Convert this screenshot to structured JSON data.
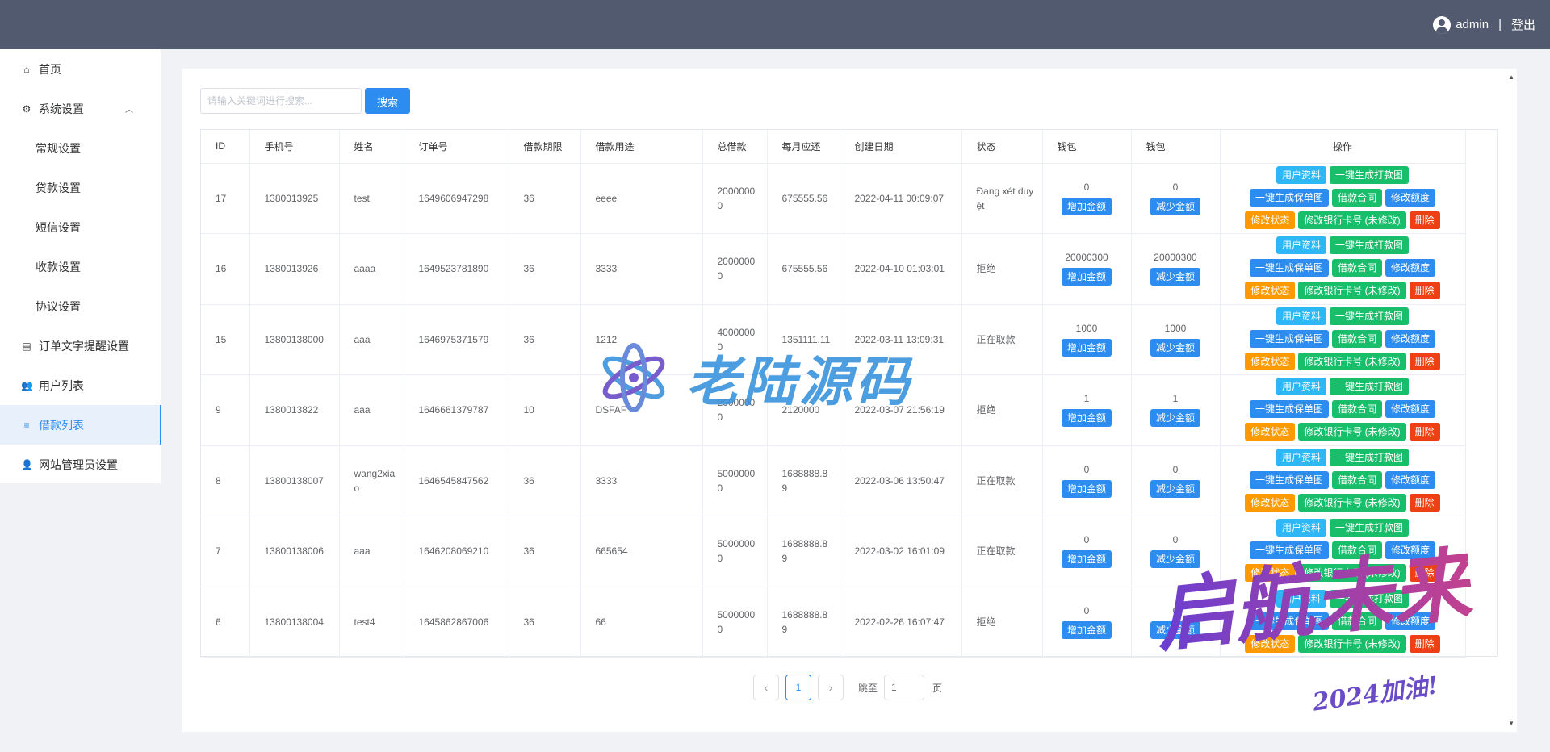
{
  "header": {
    "username": "admin",
    "separator": "|",
    "logout_label": "登出"
  },
  "sidebar": {
    "items": [
      {
        "label": "首页",
        "icon": "home-icon",
        "level": 1
      },
      {
        "label": "系统设置",
        "icon": "gear-icon",
        "level": 1,
        "expanded": true
      },
      {
        "label": "常规设置",
        "level": 2
      },
      {
        "label": "贷款设置",
        "level": 2
      },
      {
        "label": "短信设置",
        "level": 2
      },
      {
        "label": "收款设置",
        "level": 2
      },
      {
        "label": "协议设置",
        "level": 2
      },
      {
        "label": "订单文字提醒设置",
        "icon": "list-icon",
        "level": 1
      },
      {
        "label": "用户列表",
        "icon": "users-icon",
        "level": 1
      },
      {
        "label": "借款列表",
        "icon": "document-icon",
        "level": 1,
        "active": true
      },
      {
        "label": "网站管理员设置",
        "icon": "user-icon",
        "level": 1
      }
    ]
  },
  "search": {
    "placeholder": "请输入关键词进行搜索...",
    "value": "",
    "button_label": "搜索"
  },
  "table": {
    "columns": [
      "ID",
      "手机号",
      "姓名",
      "订单号",
      "借款期限",
      "借款用途",
      "总借款",
      "每月应还",
      "创建日期",
      "状态",
      "钱包",
      "钱包",
      "操作"
    ],
    "rows": [
      {
        "id": "17",
        "phone": "1380013925",
        "name": "test",
        "order": "1649606947298",
        "term": "36",
        "purpose": "eeee",
        "total": "20000000",
        "monthly": "675555.56",
        "date": "2022-04-11 00:09:07",
        "status": "Đang xét duyệt",
        "wallet_a": "0",
        "wallet_b": "0"
      },
      {
        "id": "16",
        "phone": "1380013926",
        "name": "aaaa",
        "order": "1649523781890",
        "term": "36",
        "purpose": "3333",
        "total": "20000000",
        "monthly": "675555.56",
        "date": "2022-04-10 01:03:01",
        "status": "拒绝",
        "wallet_a": "20000300",
        "wallet_b": "20000300"
      },
      {
        "id": "15",
        "phone": "13800138000",
        "name": "aaa",
        "order": "1646975371579",
        "term": "36",
        "purpose": "1212",
        "total": "40000000",
        "monthly": "1351111.11",
        "date": "2022-03-11 13:09:31",
        "status": "正在取款",
        "wallet_a": "1000",
        "wallet_b": "1000"
      },
      {
        "id": "9",
        "phone": "1380013822",
        "name": "aaa",
        "order": "1646661379787",
        "term": "10",
        "purpose": "DSFAF",
        "total": "20000000",
        "monthly": "2120000",
        "date": "2022-03-07 21:56:19",
        "status": "拒绝",
        "wallet_a": "1",
        "wallet_b": "1"
      },
      {
        "id": "8",
        "phone": "13800138007",
        "name": "wang2xiao",
        "order": "1646545847562",
        "term": "36",
        "purpose": "3333",
        "total": "50000000",
        "monthly": "1688888.89",
        "date": "2022-03-06 13:50:47",
        "status": "正在取款",
        "wallet_a": "0",
        "wallet_b": "0"
      },
      {
        "id": "7",
        "phone": "13800138006",
        "name": "aaa",
        "order": "1646208069210",
        "term": "36",
        "purpose": "665654",
        "total": "50000000",
        "monthly": "1688888.89",
        "date": "2022-03-02 16:01:09",
        "status": "正在取款",
        "wallet_a": "0",
        "wallet_b": "0"
      },
      {
        "id": "6",
        "phone": "13800138004",
        "name": "test4",
        "order": "1645862867006",
        "term": "36",
        "purpose": "66",
        "total": "50000000",
        "monthly": "1688888.89",
        "date": "2022-02-26 16:07:47",
        "status": "拒绝",
        "wallet_a": "0",
        "wallet_b": "0"
      }
    ],
    "wallet_add_label": "增加金额",
    "wallet_sub_label": "减少金额",
    "actions": {
      "user_info": "用户资料",
      "gen_transfer": "一键生成打款图",
      "gen_policy": "一键生成保单图",
      "contract": "借款合同",
      "edit_limit": "修改额度",
      "edit_status": "修改状态",
      "edit_card": "修改银行卡号 (未修改)",
      "delete": "删除"
    }
  },
  "pagination": {
    "prev": "‹",
    "current": "1",
    "next": "›",
    "jump_label": "跳至",
    "jump_value": "1",
    "page_unit": "页"
  },
  "watermarks": {
    "center_text": "老陆源码",
    "corner_text": "启航未来",
    "corner_sub": "2024加油!"
  },
  "colors": {
    "header_bg": "#515a6e",
    "primary": "#2d8cf0",
    "cyan": "#2db7f5",
    "green": "#19be6b",
    "orange": "#ff9900",
    "red": "#ed4014"
  }
}
